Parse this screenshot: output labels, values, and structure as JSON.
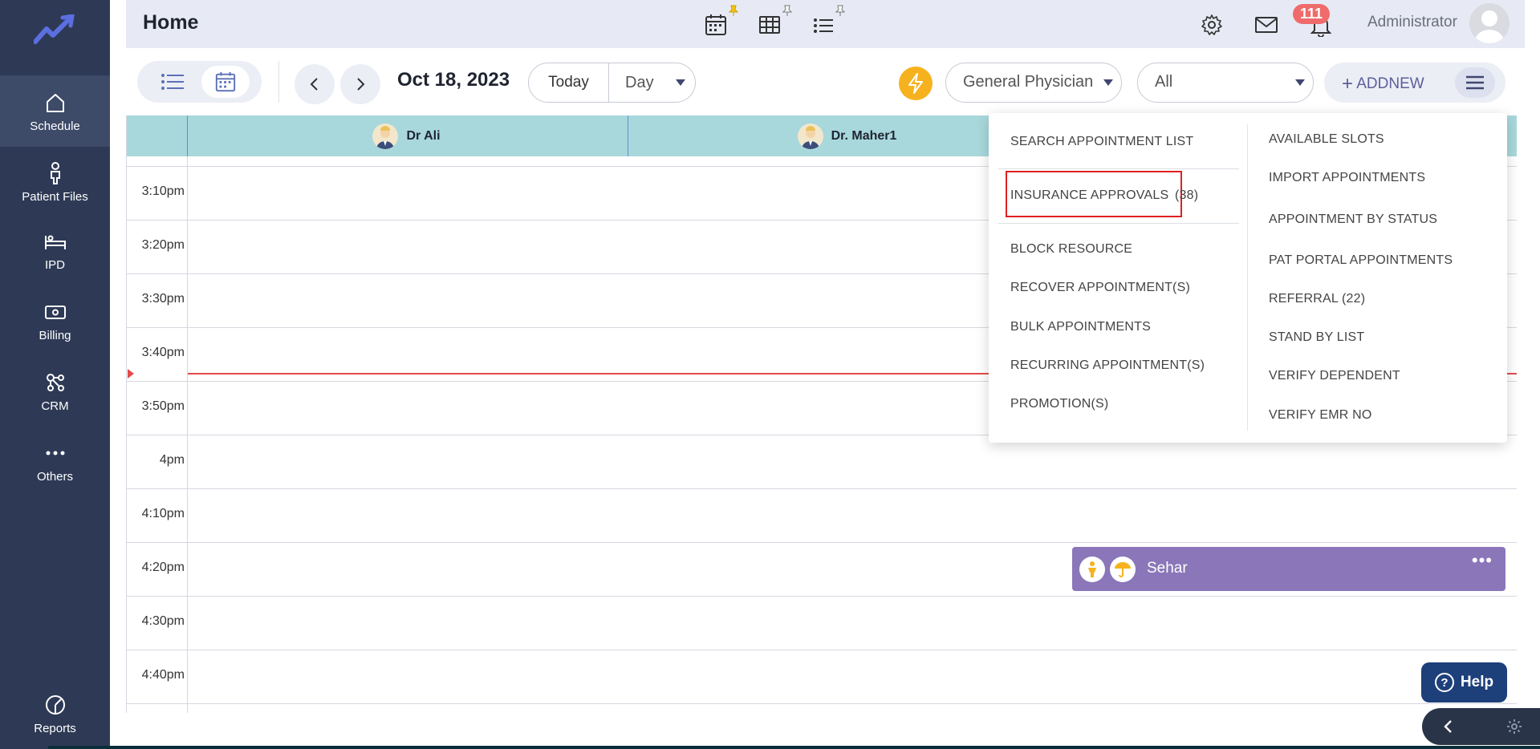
{
  "sidebar": {
    "items": [
      {
        "label": "Schedule"
      },
      {
        "label": "Patient Files"
      },
      {
        "label": "IPD"
      },
      {
        "label": "Billing"
      },
      {
        "label": "CRM"
      },
      {
        "label": "Others"
      },
      {
        "label": "Reports"
      }
    ]
  },
  "header": {
    "title": "Home",
    "admin_name": "Administrator",
    "notification_count": "111"
  },
  "toolbar": {
    "date": "Oct 18, 2023",
    "today_label": "Today",
    "view_value": "Day",
    "specialty_value": "General Physician",
    "filter_value": "All",
    "addnew_label": "ADDNEW"
  },
  "doctors": [
    {
      "name": "Dr Ali"
    },
    {
      "name": "Dr. Maher1"
    }
  ],
  "time_slots": [
    "3:10pm",
    "3:20pm",
    "3:30pm",
    "3:40pm",
    "3:50pm",
    "4pm",
    "4:10pm",
    "4:20pm",
    "4:30pm",
    "4:40pm"
  ],
  "appointment": {
    "name": "Sehar",
    "time": "4:20pm"
  },
  "dropdown": {
    "left": [
      {
        "label": "SEARCH APPOINTMENT LIST"
      },
      {
        "label": "INSURANCE APPROVALS",
        "count": "(38)"
      },
      {
        "label": "BLOCK RESOURCE"
      },
      {
        "label": "RECOVER APPOINTMENT(S)"
      },
      {
        "label": "BULK APPOINTMENTS"
      },
      {
        "label": "RECURRING APPOINTMENT(S)"
      },
      {
        "label": "PROMOTION(S)"
      }
    ],
    "right": [
      {
        "label": "AVAILABLE SLOTS"
      },
      {
        "label": "IMPORT APPOINTMENTS"
      },
      {
        "label": "APPOINTMENT BY STATUS"
      },
      {
        "label": "PAT PORTAL APPOINTMENTS"
      },
      {
        "label": "REFERRAL (22)"
      },
      {
        "label": "STAND BY LIST"
      },
      {
        "label": "VERIFY DEPENDENT"
      },
      {
        "label": "VERIFY EMR NO"
      }
    ]
  },
  "help": {
    "label": "Help"
  },
  "colors": {
    "sidebar": "#2e3a55",
    "header": "#e7eaf4",
    "doctor_header": "#a8d8dc",
    "appointment": "#8a76b8",
    "accent": "#f6b21e",
    "highlight": "#e02020"
  },
  "icons": [
    "logo-icon",
    "home-icon",
    "person-icon",
    "bed-icon",
    "billing-icon",
    "crm-icon",
    "more-icon",
    "reports-icon",
    "calendar-icon",
    "grid-icon",
    "list-icon",
    "gear-icon",
    "mail-icon",
    "bell-icon",
    "bolt-icon",
    "plus-icon",
    "menu-icon",
    "child-icon",
    "umbrella-icon",
    "help-icon"
  ]
}
